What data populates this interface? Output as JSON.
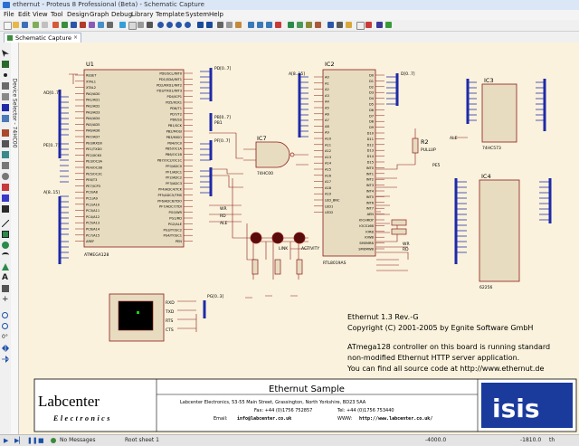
{
  "window": {
    "title": "ethernut - Proteus 8 Professional (Beta) - Schematic Capture"
  },
  "menu": [
    "File",
    "Edit",
    "View",
    "Tool",
    "Design",
    "Graph",
    "Debug",
    "Library",
    "Template",
    "System",
    "Help"
  ],
  "tab": {
    "label": "Schematic Capture",
    "close": "×"
  },
  "device_selector": {
    "label": "Device Selector - 74HC00"
  },
  "status": {
    "messages": "No Messages",
    "sheet": "Root sheet 1",
    "coord_x": "-4000.0",
    "coord_y": "-1810.0",
    "unit": "th"
  },
  "schematic": {
    "u1": {
      "ref": "U1",
      "part": "ATMEGA128",
      "left_pins": [
        "RESET",
        "XTAL1",
        "XTAL2",
        "PA0/AD0",
        "PA1/AD1",
        "PA2/AD2",
        "PA3/AD3",
        "PA4/AD4",
        "PA5/AD5",
        "PA6/AD6",
        "PA7/AD7",
        "PE0/RXD0",
        "PE1/TXD0",
        "PE2/XCK0",
        "PE3/OC3A",
        "PE4/OC3B",
        "PE5/OC3C",
        "PE6/T3",
        "PE7/ICP3",
        "PC0/A8",
        "PC1/A9",
        "PC2/A10",
        "PC3/A11",
        "PC4/A12",
        "PC5/A13",
        "PC6/A14",
        "PC7/A15",
        "AREF"
      ],
      "right_pins": [
        "PD0/SCL/INT0",
        "PD1/SDA/INT1",
        "PD2/RXD1/INT2",
        "PD3/TXD1/INT3",
        "PD4/ICP1",
        "PD5/XCK1",
        "PD6/T1",
        "PD7/T2",
        "PB0/SS",
        "PB1/SCK",
        "PB2/MOSI",
        "PB3/MISO",
        "PB4/OC0",
        "PB5/OC1A",
        "PB6/OC1B",
        "PB7/OC2/OC1C",
        "PF0/ADC0",
        "PF1/ADC1",
        "PF2/ADC2",
        "PF3/ADC3",
        "PF4/ADC4/TCK",
        "PF5/ADC5/TMS",
        "PF6/ADC6/TDO",
        "PF7/ADC7/TDI",
        "PG0/WR",
        "PG1/RD",
        "PG2/ALE",
        "PG3/TOSC2",
        "PG4/TOSC1",
        "PEN"
      ]
    },
    "ic2": {
      "ref": "IC2",
      "part": "RTL8019AS",
      "left_pins": [
        "A0",
        "A1",
        "A2",
        "A3",
        "A4",
        "A5",
        "A6",
        "A7",
        "A8",
        "A9",
        "A10",
        "A11",
        "A12",
        "A13",
        "A14",
        "A15",
        "A16",
        "A17",
        "A18",
        "A19",
        "LED_BNC",
        "LED1",
        "LED2"
      ],
      "right_pins": [
        "D0",
        "D1",
        "D2",
        "D3",
        "D4",
        "D5",
        "D6",
        "D7",
        "D8",
        "D9",
        "D10",
        "D11",
        "D12",
        "D13",
        "D14",
        "D15",
        "INT0",
        "INT1",
        "INT2",
        "INT3",
        "INT4",
        "INT5",
        "INT6",
        "INT7",
        "AEN",
        "IOCHRDY",
        "IOCS16B",
        "IORB",
        "IOWB",
        "SMEMRB",
        "SMEMWB"
      ]
    },
    "ic3": {
      "ref": "IC3",
      "part": "74HC573"
    },
    "ic4": {
      "ref": "IC4",
      "part": "62256"
    },
    "ic7": {
      "ref": "IC7",
      "part": "74HC00"
    },
    "r2": {
      "ref": "R2",
      "value": "PULLUP"
    },
    "leds": [
      "LINK",
      "ACTIVITY"
    ],
    "bus_labels": {
      "ad": "AD[0..7]",
      "a": "A[8..15]",
      "pf": "PF[0..7]",
      "pb": "PB[0..7]",
      "pd": "PD[0..7]",
      "pe": "PE[0..7]",
      "pg": "PG[0..3]",
      "d": "D[0..7]"
    },
    "net_labels": {
      "wr": "WR",
      "rd": "RD",
      "ale": "ALE",
      "pe5": "PE5",
      "pb1": "PB1"
    },
    "rs232_pins": [
      "RXD",
      "TXD",
      "RTS",
      "CTS"
    ],
    "notes": [
      "Ethernut 1.3 Rev.-G",
      "Copyright (C) 2001-2005 by Egnite Software GmbH",
      "ATmega128 controller on this board is running standard",
      "non-modified Ethernut HTTP server application.",
      "You can find all source code at http://www.ethernut.de"
    ],
    "title_block": {
      "logo_top": "Labcenter",
      "logo_bottom": "Electronics",
      "title": "Ethernut Sample",
      "address": "Labcenter Electronics,     53-55 Main Street,     Grassington,     North Yorkshire,     BD23 5AA",
      "fax": "Fax: +44 (0)1756 752857",
      "tel": "Tel: +44 (0)1756 753440",
      "email_label": "Email:",
      "email": "info@labcenter.co.uk",
      "www_label": "WWW:",
      "www": "http://www.labcenter.co.uk/",
      "isis": "isis"
    }
  },
  "colors": {
    "canvas": "#faf2dc",
    "wire": "#8b1a1a",
    "bus": "#1e2aa8",
    "ink": "#000000"
  }
}
